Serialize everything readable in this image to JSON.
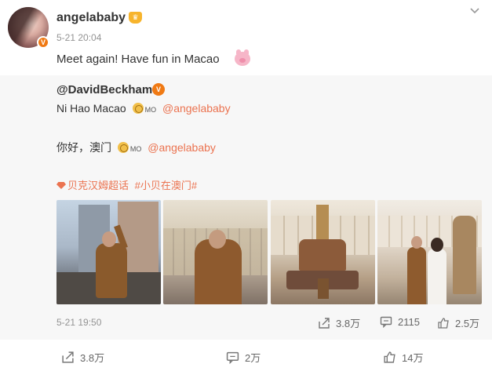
{
  "post": {
    "username": "angelababy",
    "verified_badge": "V",
    "time": "5-21 20:04",
    "text": "Meet again! Have fun in Macao",
    "menu_icon": "chevron-down-icon"
  },
  "repost": {
    "username": "@DavidBeckham",
    "verified_badge": "V",
    "line1_text": "Ni Hao Macao",
    "line2_text": "你好，澳门",
    "emoji_mo": "MO",
    "mention": "@angelababy",
    "topic1": "贝克汉姆超话",
    "topic2": "#小贝在澳门#",
    "time": "5-21 19:50",
    "stats": {
      "share": "3.8万",
      "comment": "2115",
      "like": "2.5万"
    }
  },
  "footer": {
    "share": "3.8万",
    "comment": "2万",
    "like": "14万"
  },
  "colors": {
    "accent": "#eb7350",
    "badge": "#f07a14",
    "muted": "#939393",
    "repost_bg": "#f7f7f7"
  }
}
